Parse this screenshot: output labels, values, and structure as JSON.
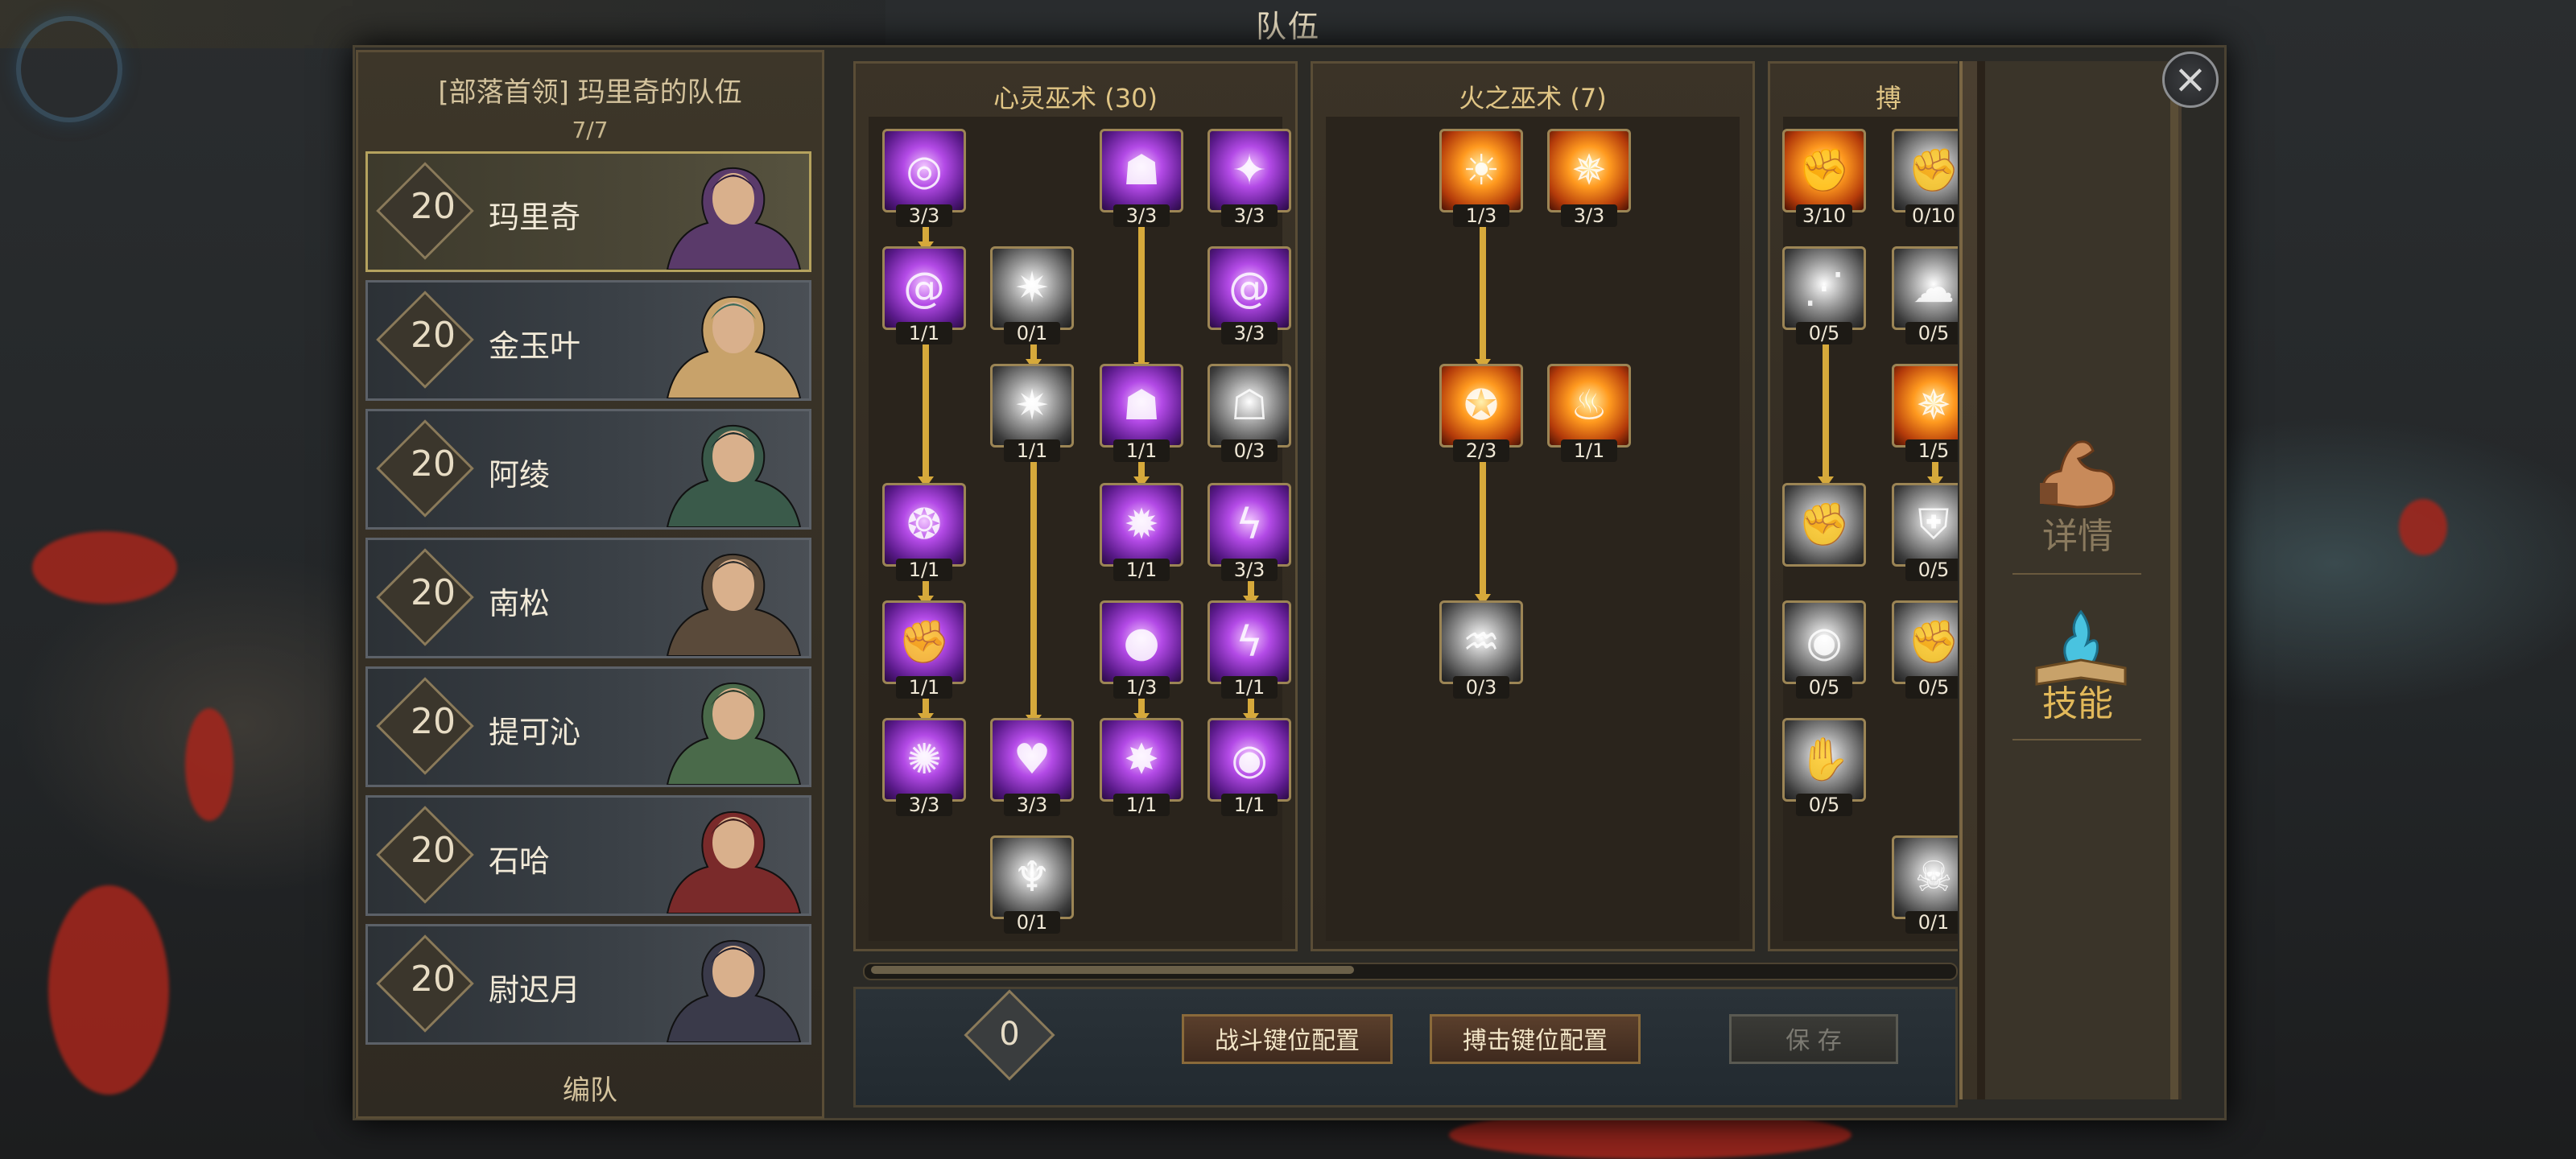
{
  "screen_title": "队伍",
  "party": {
    "title": "[部落首领] 玛里奇的队伍",
    "count": "7/7",
    "members": [
      {
        "level": "20",
        "name": "玛里奇",
        "selected": true
      },
      {
        "level": "20",
        "name": "金玉叶",
        "selected": false
      },
      {
        "level": "20",
        "name": "阿绫",
        "selected": false
      },
      {
        "level": "20",
        "name": "南松",
        "selected": false
      },
      {
        "level": "20",
        "name": "提可沁",
        "selected": false
      },
      {
        "level": "20",
        "name": "石哈",
        "selected": false
      },
      {
        "level": "20",
        "name": "尉迟月",
        "selected": false
      }
    ],
    "formation_label": "编队"
  },
  "skill_trees": [
    {
      "title": "心灵巫术 (30)",
      "skills": [
        {
          "rank": "3/3",
          "style": "purple",
          "icon": "vortex-icon"
        },
        {
          "rank": "3/3",
          "style": "purple",
          "icon": "demon-face-icon"
        },
        {
          "rank": "3/3",
          "style": "purple",
          "icon": "spark-icon"
        },
        {
          "rank": "1/1",
          "style": "purple",
          "icon": "spiral-icon"
        },
        {
          "rank": "0/1",
          "style": "grey",
          "icon": "flash-icon"
        },
        {
          "rank": "3/3",
          "style": "purple",
          "icon": "spiral-icon"
        },
        {
          "rank": "1/1",
          "style": "grey",
          "icon": "flash-icon"
        },
        {
          "rank": "1/1",
          "style": "purple",
          "icon": "demon-face-icon"
        },
        {
          "rank": "0/3",
          "style": "grey",
          "icon": "hood-icon"
        },
        {
          "rank": "1/1",
          "style": "purple",
          "icon": "swirl-icon"
        },
        {
          "rank": "1/1",
          "style": "purple",
          "icon": "beetle-icon"
        },
        {
          "rank": "3/3",
          "style": "purple",
          "icon": "lightning-icon"
        },
        {
          "rank": "1/1",
          "style": "purple",
          "icon": "fist-icon"
        },
        {
          "rank": "1/3",
          "style": "purple",
          "icon": "orb-icon"
        },
        {
          "rank": "1/1",
          "style": "purple",
          "icon": "lightning-icon"
        },
        {
          "rank": "3/3",
          "style": "purple",
          "icon": "blast-icon"
        },
        {
          "rank": "3/3",
          "style": "purple",
          "icon": "heart-icon"
        },
        {
          "rank": "1/1",
          "style": "purple",
          "icon": "burst-icon"
        },
        {
          "rank": "1/1",
          "style": "purple",
          "icon": "eye-icon"
        },
        {
          "rank": "0/1",
          "style": "grey",
          "icon": "mask-icon"
        }
      ]
    },
    {
      "title": "火之巫术 (7)",
      "skills": [
        {
          "rank": "1/3",
          "style": "fire",
          "icon": "sun-icon"
        },
        {
          "rank": "3/3",
          "style": "fire",
          "icon": "flame-burst-icon"
        },
        {
          "rank": "2/3",
          "style": "fire",
          "icon": "fire-orb-icon"
        },
        {
          "rank": "1/1",
          "style": "fire",
          "icon": "fire-man-icon"
        },
        {
          "rank": "0/3",
          "style": "grey",
          "icon": "fire-pillar-icon"
        }
      ]
    },
    {
      "title": "搏",
      "skills": [
        {
          "rank": "3/10",
          "style": "fire",
          "icon": "fist-icon"
        },
        {
          "rank": "0/10",
          "style": "grey",
          "icon": "fist-icon"
        },
        {
          "rank": "0/5",
          "style": "grey",
          "icon": "claw-icon"
        },
        {
          "rank": "0/5",
          "style": "grey",
          "icon": "smoke-icon"
        },
        {
          "rank": "1/5",
          "style": "fire",
          "icon": "flame-burst-icon"
        },
        {
          "rank": "",
          "style": "grey",
          "icon": "fist-icon"
        },
        {
          "rank": "0/5",
          "style": "grey",
          "icon": "shield-icon"
        },
        {
          "rank": "0/5",
          "style": "grey",
          "icon": "eye-icon"
        },
        {
          "rank": "0/5",
          "style": "grey",
          "icon": "fist-icon"
        },
        {
          "rank": "0/5",
          "style": "grey",
          "icon": "hand-icon"
        },
        {
          "rank": "0/1",
          "style": "grey",
          "icon": "skull-icon"
        }
      ]
    }
  ],
  "bottom_bar": {
    "skill_points": "0",
    "combat_keys_button": "战斗键位配置",
    "grapple_keys_button": "搏击键位配置",
    "save_button": "保 存"
  },
  "side_tabs": {
    "details": "详情",
    "skills": "技能"
  },
  "colors": {
    "accent_gold": "#d6a93b",
    "purple_skill": "#b34ae6",
    "fire_skill": "#ff9a1f"
  }
}
